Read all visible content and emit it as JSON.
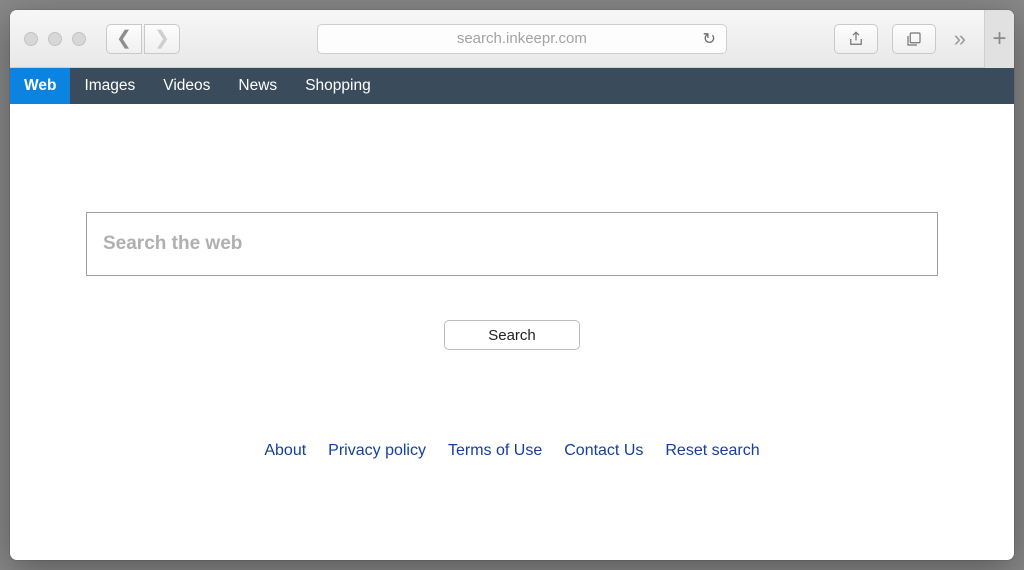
{
  "browser": {
    "url": "search.inkeepr.com"
  },
  "nav": {
    "tabs": [
      {
        "label": "Web",
        "active": true
      },
      {
        "label": "Images",
        "active": false
      },
      {
        "label": "Videos",
        "active": false
      },
      {
        "label": "News",
        "active": false
      },
      {
        "label": "Shopping",
        "active": false
      }
    ]
  },
  "search": {
    "placeholder": "Search the web",
    "value": "",
    "button_label": "Search"
  },
  "footer": {
    "links": [
      {
        "label": "About"
      },
      {
        "label": "Privacy policy"
      },
      {
        "label": "Terms of Use"
      },
      {
        "label": "Contact Us"
      },
      {
        "label": "Reset search"
      }
    ]
  }
}
